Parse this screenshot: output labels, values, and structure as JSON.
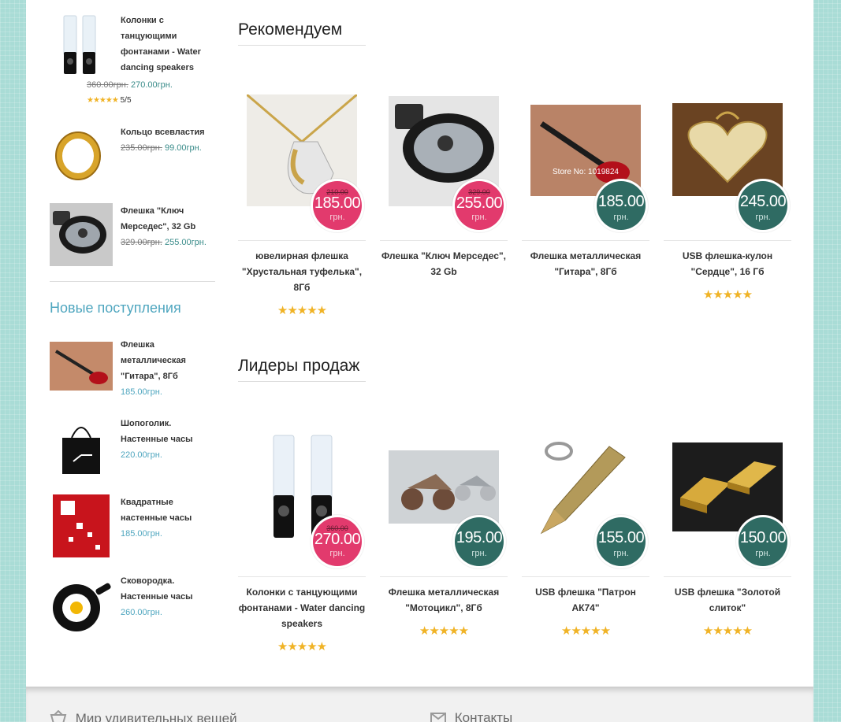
{
  "sidebar": {
    "items": [
      {
        "title": "Колонки с танцующими фонтанами - Water dancing speakers",
        "old_price": "360.00грн.",
        "new_price": "270.00грн.",
        "rating": "5/5"
      },
      {
        "title": "Кольцо всевластия",
        "old_price": "235.00грн.",
        "new_price": "99.00грн."
      },
      {
        "title": "Флешка \"Ключ Мерседес\", 32 Gb",
        "old_price": "329.00грн.",
        "new_price": "255.00грн."
      }
    ],
    "new_heading": "Новые поступления",
    "new_items": [
      {
        "title": "Флешка металлическая \"Гитара\", 8Гб",
        "price": "185.00грн."
      },
      {
        "title": "Шопоголик. Настенные часы",
        "price": "220.00грн."
      },
      {
        "title": "Квадратные настенные часы",
        "price": "185.00грн."
      },
      {
        "title": "Сковородка. Настенные часы",
        "price": "260.00грн."
      }
    ]
  },
  "recommended": {
    "title": "Рекомендуем",
    "products": [
      {
        "name": "ювелирная флешка \"Хрустальная туфелька\", 8Гб",
        "old_price": "210.00",
        "price": "185.00",
        "currency": "грн.",
        "rating": "★★★★★"
      },
      {
        "name": "Флешка \"Ключ Мерседес\", 32 Gb",
        "old_price": "329.00",
        "price": "255.00",
        "currency": "грн."
      },
      {
        "name": "Флешка металлическая \"Гитара\", 8Гб",
        "price": "185.00",
        "currency": "грн."
      },
      {
        "name": "USB флешка-кулон \"Сердце\", 16 Гб",
        "price": "245.00",
        "currency": "грн.",
        "rating": "★★★★★"
      }
    ]
  },
  "bestsellers": {
    "title": "Лидеры продаж",
    "products": [
      {
        "name": "Колонки с танцующими фонтанами - Water dancing speakers",
        "old_price": "360.00",
        "price": "270.00",
        "currency": "грн.",
        "rating": "★★★★★"
      },
      {
        "name": "Флешка металлическая \"Мотоцикл\", 8Гб",
        "price": "195.00",
        "currency": "грн.",
        "rating": "★★★★★"
      },
      {
        "name": "USB флешка \"Патрон АК74\"",
        "price": "155.00",
        "currency": "грн.",
        "rating": "★★★★★"
      },
      {
        "name": "USB флешка \"Золотой слиток\"",
        "price": "150.00",
        "currency": "грн.",
        "rating": "★★★★★"
      }
    ]
  },
  "footer": {
    "about": "Мир удивительных вещей",
    "contacts": "Контакты"
  },
  "small_stars": "★★★★★",
  "colors": {
    "accent": "#4fa6bf",
    "sale_badge": "#e23a6d",
    "price_badge": "#2f6b63",
    "star": "#f0b326"
  }
}
